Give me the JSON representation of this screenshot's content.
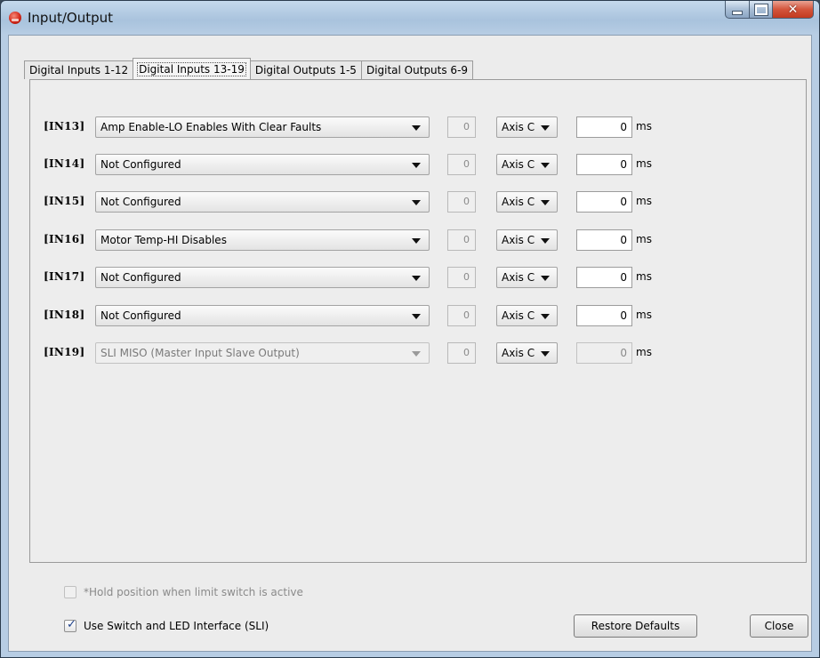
{
  "window": {
    "title": "Input/Output"
  },
  "tabs": [
    {
      "label": "Digital Inputs 1-12",
      "active": false
    },
    {
      "label": "Digital Inputs 13-19",
      "active": true
    },
    {
      "label": "Digital Outputs 1-5",
      "active": false
    },
    {
      "label": "Digital Outputs 6-9",
      "active": false
    }
  ],
  "inputs": [
    {
      "label": "[IN13]",
      "function": "Amp Enable-LO Enables With Clear Faults",
      "number": "0",
      "axis": "Axis C",
      "debounce": "0",
      "unit": "ms",
      "enabled": true
    },
    {
      "label": "[IN14]",
      "function": "Not Configured",
      "number": "0",
      "axis": "Axis C",
      "debounce": "0",
      "unit": "ms",
      "enabled": true
    },
    {
      "label": "[IN15]",
      "function": "Not Configured",
      "number": "0",
      "axis": "Axis C",
      "debounce": "0",
      "unit": "ms",
      "enabled": true
    },
    {
      "label": "[IN16]",
      "function": "Motor Temp-HI Disables",
      "number": "0",
      "axis": "Axis C",
      "debounce": "0",
      "unit": "ms",
      "enabled": true
    },
    {
      "label": "[IN17]",
      "function": "Not Configured",
      "number": "0",
      "axis": "Axis C",
      "debounce": "0",
      "unit": "ms",
      "enabled": true
    },
    {
      "label": "[IN18]",
      "function": "Not Configured",
      "number": "0",
      "axis": "Axis C",
      "debounce": "0",
      "unit": "ms",
      "enabled": true
    },
    {
      "label": "[IN19]",
      "function": "SLI MISO (Master Input Slave Output)",
      "number": "0",
      "axis": "Axis C",
      "debounce": "0",
      "unit": "ms",
      "enabled": false
    }
  ],
  "options": {
    "hold_position": {
      "label": "*Hold position when limit switch is active",
      "checked": false,
      "enabled": false
    },
    "use_sli": {
      "label": "Use Switch and LED Interface (SLI)",
      "checked": true,
      "enabled": true
    }
  },
  "buttons": {
    "restore_defaults": "Restore Defaults",
    "close": "Close"
  }
}
